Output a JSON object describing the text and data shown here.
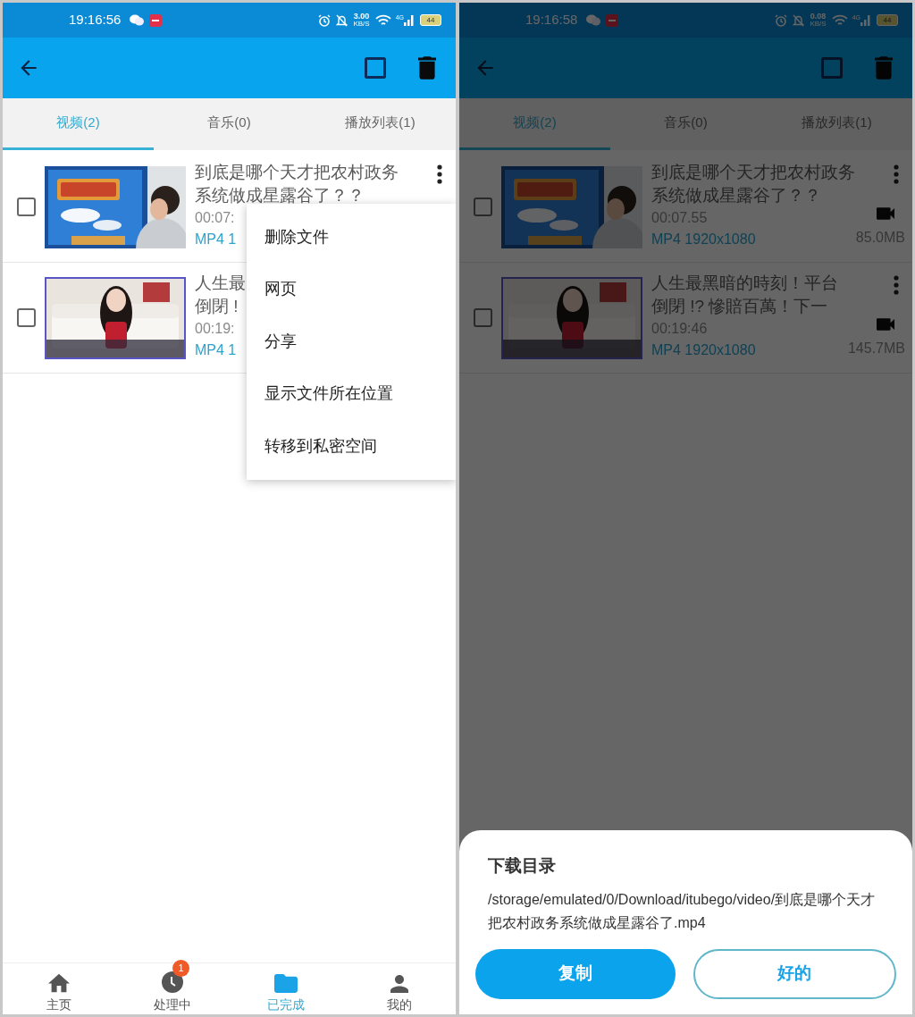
{
  "screens": [
    {
      "dimmed": false,
      "status_bar": {
        "time": "19:16:56",
        "net_speed": "3.00",
        "net_unit": "KB/S",
        "network": "4G",
        "battery": "44"
      },
      "tabs": [
        {
          "label": "视频(2)",
          "selected": true
        },
        {
          "label": "音乐(0)",
          "selected": false
        },
        {
          "label": "播放列表(1)",
          "selected": false
        }
      ],
      "items": [
        {
          "checked": false,
          "title_lines": [
            "到底是哪个天才把农村政务",
            "系统做成星露谷了？？"
          ],
          "duration": "00:07:",
          "format": "MP4 1"
        },
        {
          "checked": false,
          "title_lines": [
            "人生最",
            "倒閉 !"
          ],
          "duration": "00:19:",
          "format": "MP4 1"
        }
      ],
      "popup_menu": {
        "items": [
          "删除文件",
          "网页",
          "分享",
          "显示文件所在位置",
          "转移到私密空间"
        ]
      },
      "bottom_nav": [
        {
          "label": "主页",
          "selected": false
        },
        {
          "label": "处理中",
          "selected": false,
          "badge": "1"
        },
        {
          "label": "已完成",
          "selected": true
        },
        {
          "label": "我的",
          "selected": false
        }
      ]
    },
    {
      "dimmed": true,
      "status_bar": {
        "time": "19:16:58",
        "net_speed": "0.08",
        "net_unit": "KB/S",
        "network": "4G",
        "battery": "44"
      },
      "tabs": [
        {
          "label": "视频(2)",
          "selected": true
        },
        {
          "label": "音乐(0)",
          "selected": false
        },
        {
          "label": "播放列表(1)",
          "selected": false
        }
      ],
      "items": [
        {
          "checked": false,
          "title_lines": [
            "到底是哪个天才把农村政务",
            "系统做成星露谷了？？"
          ],
          "duration": "00:07.55",
          "format": "MP4 1920x1080",
          "size": "85.0MB"
        },
        {
          "checked": false,
          "title_lines": [
            "人生最黑暗的時刻！平台",
            "倒閉 !? 慘賠百萬！下一"
          ],
          "duration": "00:19:46",
          "format": "MP4 1920x1080",
          "size": "145.7MB"
        }
      ],
      "bottom_sheet": {
        "title": "下载目录",
        "path": "/storage/emulated/0/Download/itubego/video/到底是哪个天才把农村政务系统做成星露谷了.mp4",
        "buttons": [
          {
            "label": "复制",
            "kind": "filled"
          },
          {
            "label": "好的",
            "kind": "outlined"
          }
        ]
      }
    }
  ]
}
